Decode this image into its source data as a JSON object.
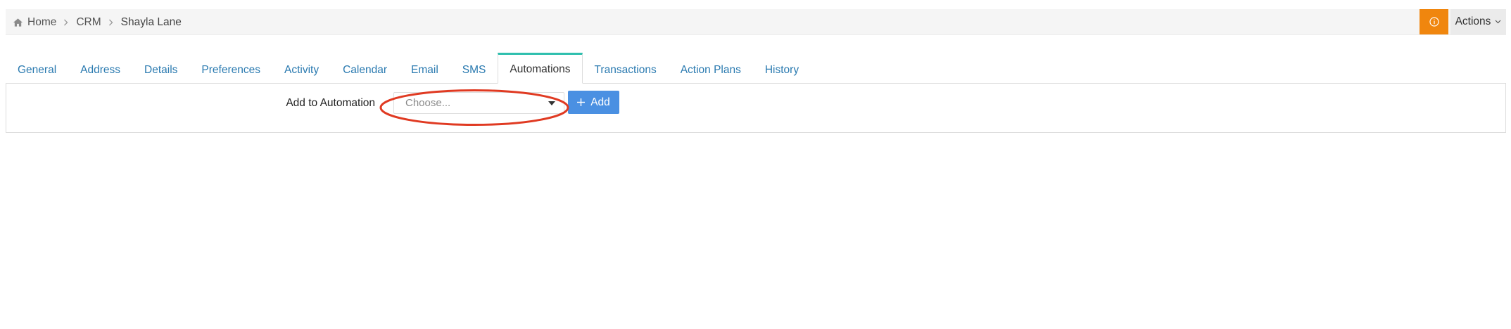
{
  "breadcrumb": {
    "items": [
      "Home",
      "CRM",
      "Shayla Lane"
    ]
  },
  "header": {
    "actions_label": "Actions",
    "info_icon": "info-circle-icon",
    "info_color": "#f0860e"
  },
  "tabs": [
    {
      "label": "General",
      "active": false
    },
    {
      "label": "Address",
      "active": false
    },
    {
      "label": "Details",
      "active": false
    },
    {
      "label": "Preferences",
      "active": false
    },
    {
      "label": "Activity",
      "active": false
    },
    {
      "label": "Calendar",
      "active": false
    },
    {
      "label": "Email",
      "active": false
    },
    {
      "label": "SMS",
      "active": false
    },
    {
      "label": "Automations",
      "active": true
    },
    {
      "label": "Transactions",
      "active": false
    },
    {
      "label": "Action Plans",
      "active": false
    },
    {
      "label": "History",
      "active": false
    }
  ],
  "automation_form": {
    "label": "Add to Automation",
    "select_placeholder": "Choose...",
    "add_button_label": "Add",
    "add_button_color": "#4a90e2"
  },
  "colors": {
    "accent_tab": "#2fbfae",
    "link": "#2a7ab0",
    "annotation": "#e03a22"
  }
}
